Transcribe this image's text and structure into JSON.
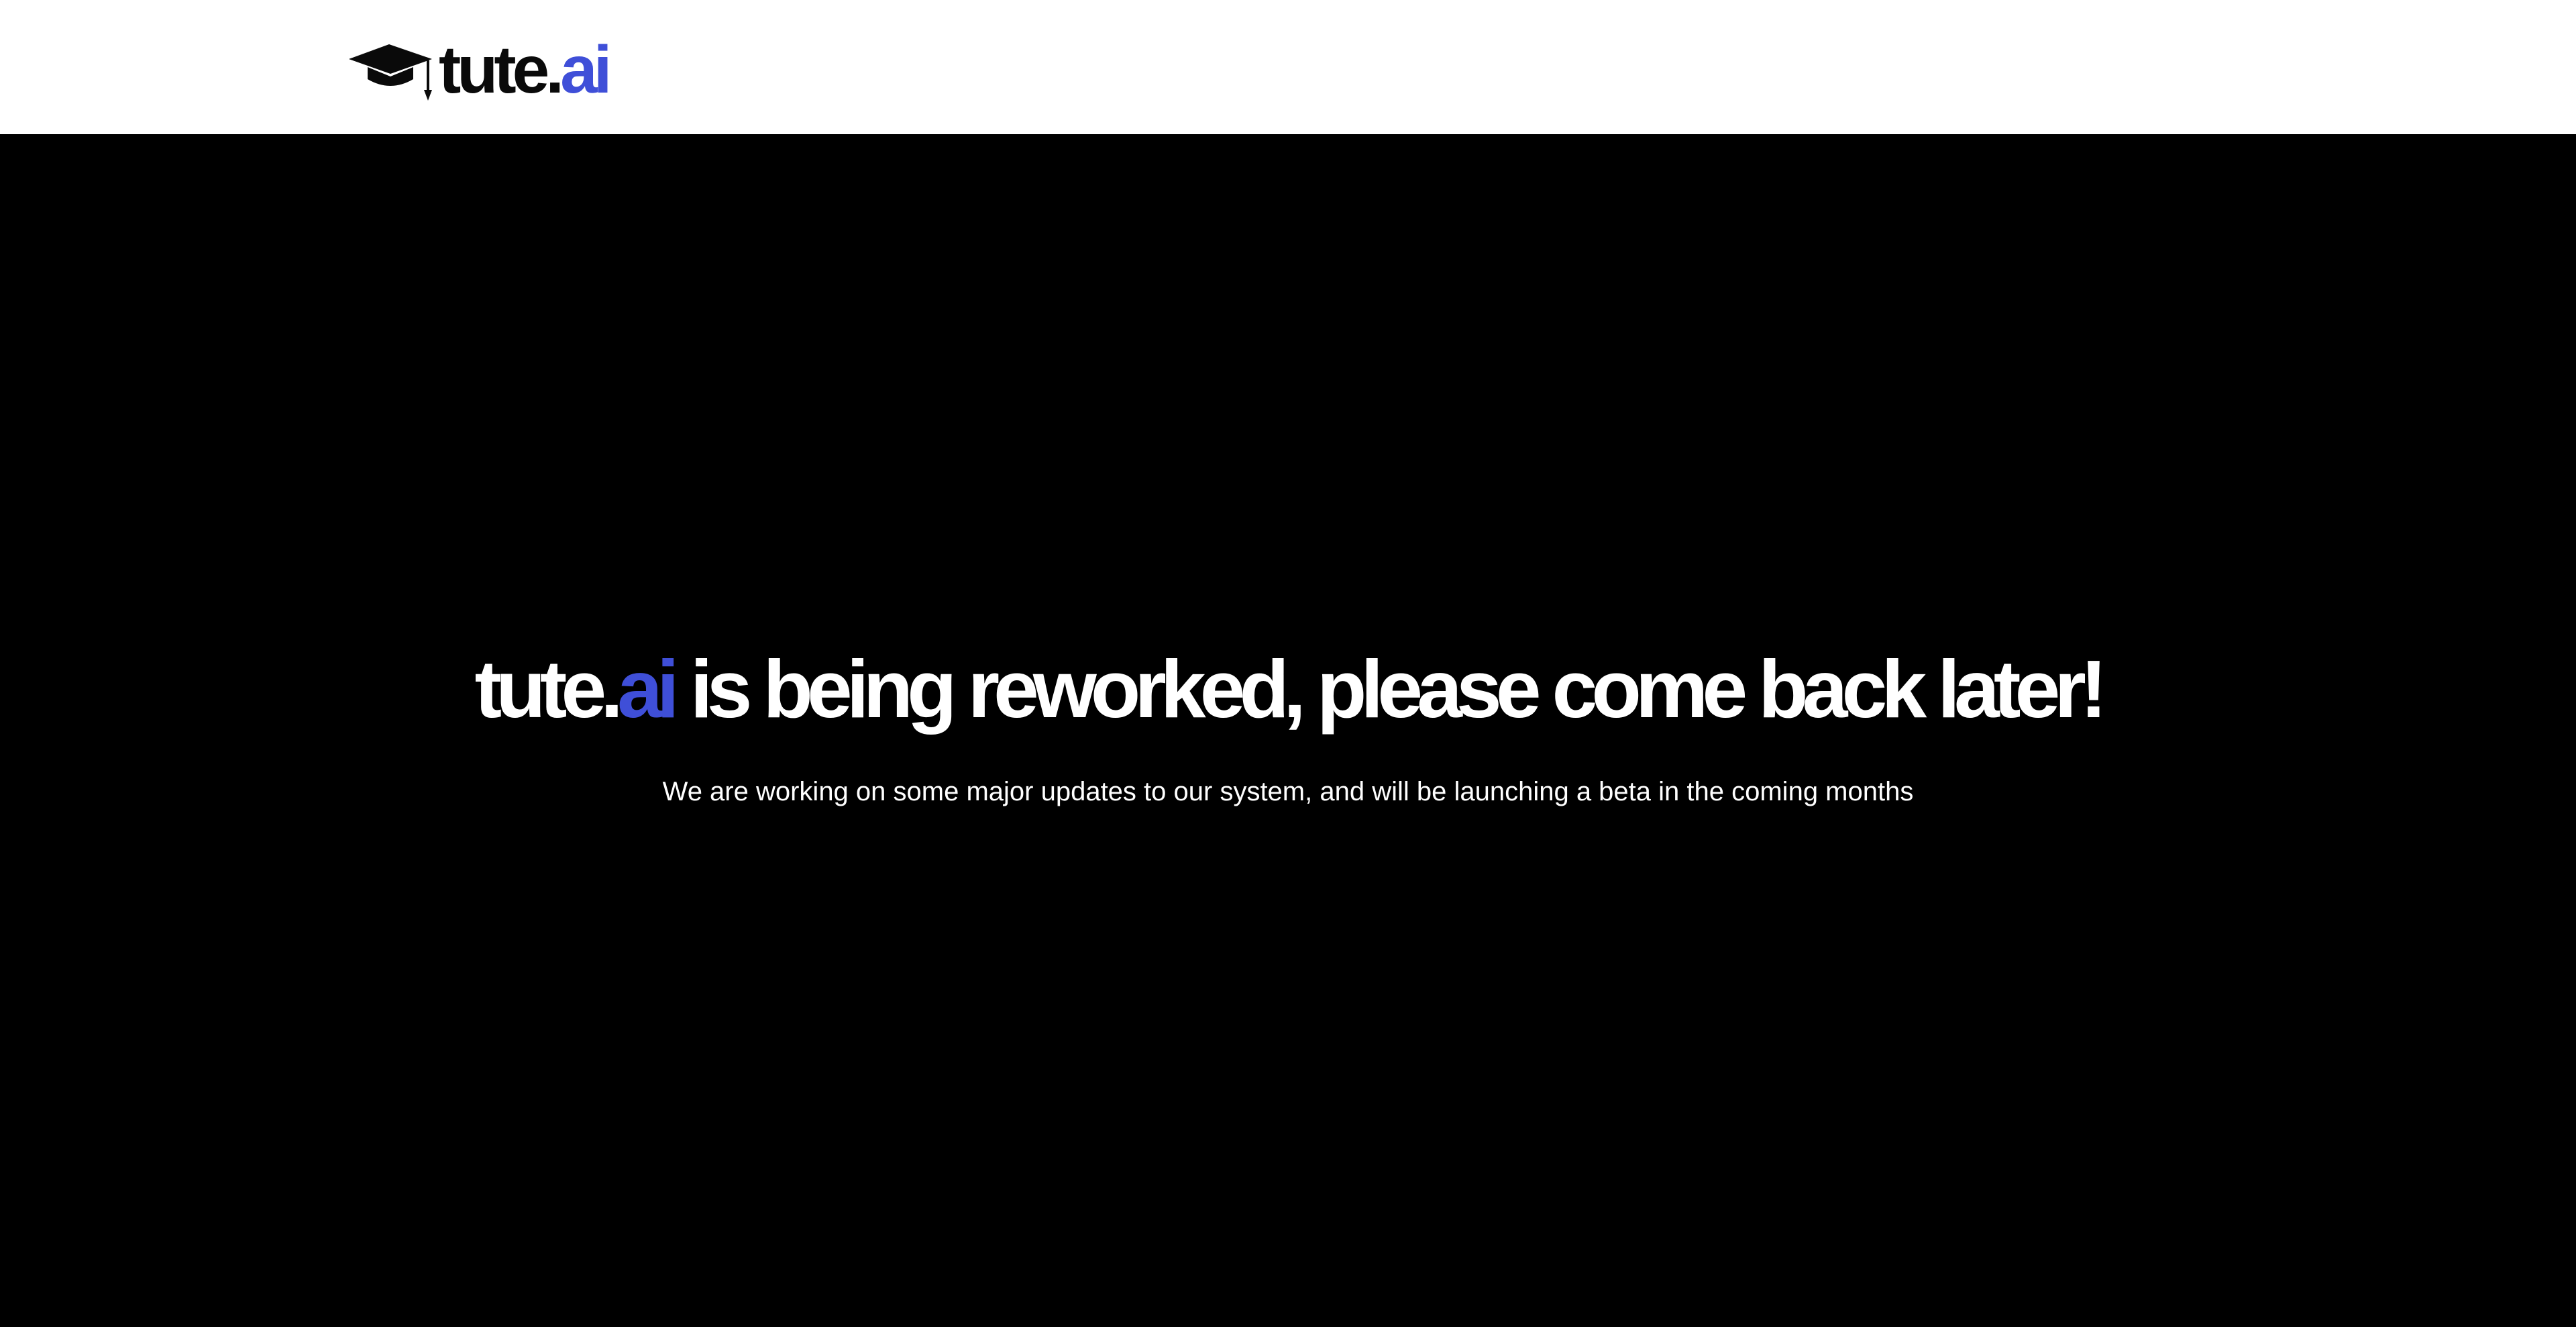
{
  "brand": {
    "name_main": "tute.",
    "name_accent": "ai",
    "logo_icon": "graduation-cap-icon",
    "accent_color": "#3f4fd8"
  },
  "hero": {
    "headline_brand_main": "tute.",
    "headline_brand_accent": "ai",
    "headline_rest": " is being reworked, please come back later!",
    "subtitle": "We are working on some major updates to our system, and will be launching a beta in the coming months"
  },
  "colors": {
    "header_bg": "#ffffff",
    "hero_bg": "#000000",
    "text_light": "#ffffff",
    "text_dark": "#0a0a0a"
  }
}
